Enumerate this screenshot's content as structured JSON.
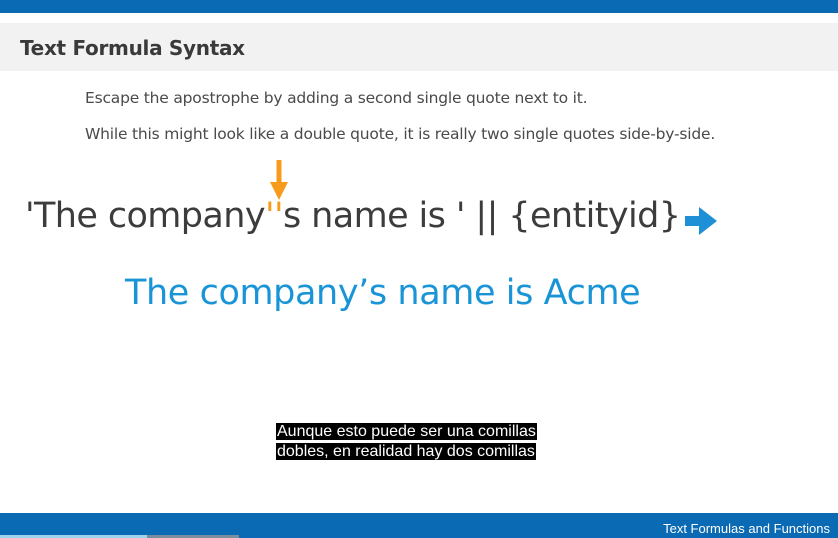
{
  "slide": {
    "title": "Text Formula Syntax",
    "lines": [
      "Escape the apostrophe by adding a second single quote next to it.",
      "While this might look like a double quote, it is really two single quotes side-by-side."
    ],
    "formula": {
      "before": "'The company",
      "highlight": "''",
      "after": "s name is ' || {entityid}"
    },
    "result": "The company’s name is Acme",
    "arrow_down_icon": "arrow-down-icon",
    "arrow_right_icon": "arrow-right-icon"
  },
  "subtitle": {
    "line1": "Aunque esto puede ser una comillas",
    "line2": "dobles, en realidad hay dos comillas"
  },
  "footer": {
    "text": "Text Formulas and Functions"
  },
  "progress": {
    "played_fraction": 0.176,
    "buffered_fraction": 0.285
  },
  "colors": {
    "brand_blue": "#0a6ab4",
    "accent_orange": "#f79b1c",
    "result_blue": "#1994d6",
    "arrow_blue": "#1f8fd6"
  }
}
